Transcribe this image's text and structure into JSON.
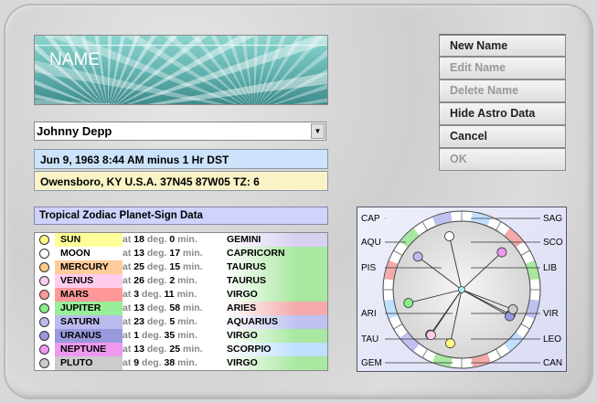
{
  "banner": {
    "title": "NAME"
  },
  "person": {
    "selected": "Johnny Depp",
    "birth": "Jun 9, 1963  8:44 AM  minus 1 Hr DST",
    "place": "Owensboro, KY U.S.A.  37N45  87W05 TZ: 6"
  },
  "data_title": "Tropical Zodiac Planet-Sign Data",
  "labels": {
    "at": "at",
    "deg": "deg.",
    "min": "min."
  },
  "planets": [
    {
      "name": "SUN",
      "deg": "18",
      "min": "0",
      "sign": "GEMINI",
      "color": "#ffff99",
      "dot": "#ffff88",
      "sign_color": "#d8d0f0"
    },
    {
      "name": "MOON",
      "deg": "13",
      "min": "17",
      "sign": "CAPRICORN",
      "color": "#ffffff",
      "dot": "#ffffff",
      "sign_color": "#a8e8a0"
    },
    {
      "name": "MERCURY",
      "deg": "25",
      "min": "15",
      "sign": "TAURUS",
      "color": "#ffcc99",
      "dot": "#ffcc88",
      "sign_color": "#a8e8a0"
    },
    {
      "name": "VENUS",
      "deg": "26",
      "min": "2",
      "sign": "TAURUS",
      "color": "#ffccee",
      "dot": "#ffccee",
      "sign_color": "#a8e8a0"
    },
    {
      "name": "MARS",
      "deg": "3",
      "min": "11",
      "sign": "VIRGO",
      "color": "#ff9999",
      "dot": "#ff9999",
      "sign_color": "#a8e8a0"
    },
    {
      "name": "JUPITER",
      "deg": "13",
      "min": "58",
      "sign": "ARIES",
      "color": "#99ee99",
      "dot": "#88ee88",
      "sign_color": "#f4aaaa"
    },
    {
      "name": "SATURN",
      "deg": "23",
      "min": "5",
      "sign": "AQUARIUS",
      "color": "#bbbbee",
      "dot": "#bbbbee",
      "sign_color": "#bfc2f0"
    },
    {
      "name": "URANUS",
      "deg": "1",
      "min": "35",
      "sign": "VIRGO",
      "color": "#9999dd",
      "dot": "#9999dd",
      "sign_color": "#a8e8a0"
    },
    {
      "name": "NEPTUNE",
      "deg": "13",
      "min": "25",
      "sign": "SCORPIO",
      "color": "#ee99ee",
      "dot": "#ee99ee",
      "sign_color": "#bfe0ff"
    },
    {
      "name": "PLUTO",
      "deg": "9",
      "min": "38",
      "sign": "VIRGO",
      "color": "#cccccc",
      "dot": "#cccccc",
      "sign_color": "#a8e8a0"
    }
  ],
  "buttons": [
    {
      "label": "New Name",
      "enabled": true
    },
    {
      "label": "Edit Name",
      "enabled": false
    },
    {
      "label": "Delete Name",
      "enabled": false
    },
    {
      "label": "Hide Astro Data",
      "enabled": true
    },
    {
      "label": "Cancel",
      "enabled": true
    },
    {
      "label": "OK",
      "enabled": false
    }
  ],
  "wheel": {
    "signs_left": [
      "CAP",
      "AQU",
      "PIS",
      "ARI",
      "TAU",
      "GEM"
    ],
    "signs_right": [
      "SAG",
      "SCO",
      "LIB",
      "VIR",
      "LEO",
      "CAN"
    ],
    "planet_markers": [
      {
        "planet": "SUN",
        "lon": 78,
        "color": "#ffff88"
      },
      {
        "planet": "MOON",
        "lon": 283,
        "color": "#ffffff"
      },
      {
        "planet": "MERCURY",
        "lon": 55,
        "color": "#ffcc88"
      },
      {
        "planet": "VENUS",
        "lon": 56,
        "color": "#ffccee"
      },
      {
        "planet": "MARS",
        "lon": 153,
        "color": "#ff9999"
      },
      {
        "planet": "JUPITER",
        "lon": 14,
        "color": "#88ee88"
      },
      {
        "planet": "SATURN",
        "lon": 323,
        "color": "#bbbbee"
      },
      {
        "planet": "URANUS",
        "lon": 151,
        "color": "#9999dd"
      },
      {
        "planet": "NEPTUNE",
        "lon": 223,
        "color": "#ee99ee"
      },
      {
        "planet": "PLUTO",
        "lon": 159,
        "color": "#cccccc"
      }
    ]
  }
}
